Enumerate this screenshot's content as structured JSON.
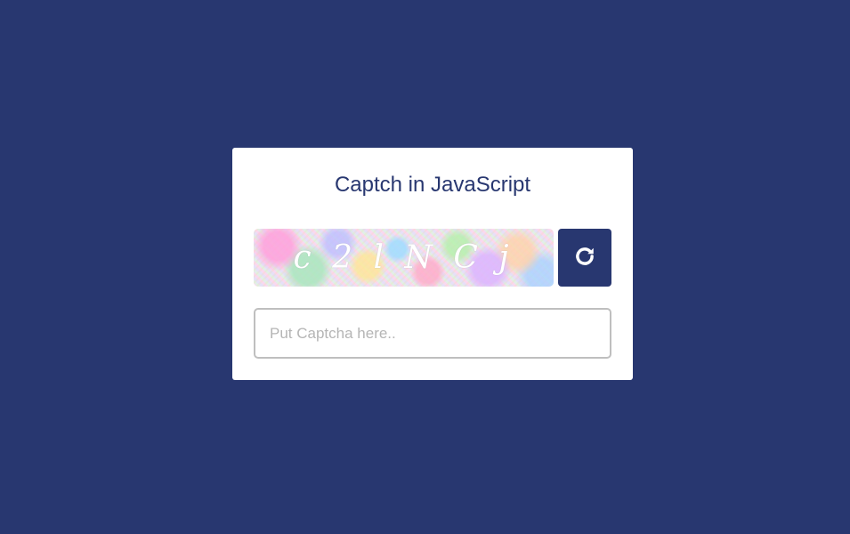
{
  "card": {
    "title": "Captch in JavaScript"
  },
  "captcha": {
    "text": "c 2 l N C j",
    "refresh_icon": "refresh-icon"
  },
  "input": {
    "value": "",
    "placeholder": "Put Captcha here.."
  },
  "colors": {
    "background": "#283770",
    "card": "#ffffff",
    "accent": "#283770",
    "input_border": "#bfbfbf",
    "placeholder": "#b5b5b5"
  }
}
